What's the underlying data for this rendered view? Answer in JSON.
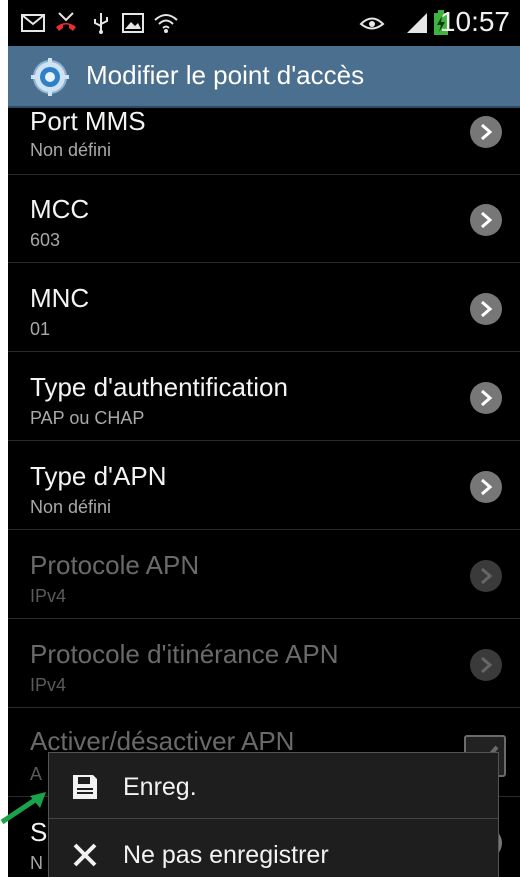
{
  "status_bar": {
    "time": "10:57",
    "icons": [
      "mail-icon",
      "missed-call-icon",
      "usb-icon",
      "gallery-icon",
      "wifi-icon",
      "smart-stay-eye-icon",
      "signal-icon",
      "battery-charging-icon"
    ]
  },
  "action_bar": {
    "title": "Modifier le point d'accès",
    "icon": "gear-icon"
  },
  "settings": [
    {
      "title": "Port MMS",
      "value": "Non défini",
      "enabled": true
    },
    {
      "title": "MCC",
      "value": "603",
      "enabled": true
    },
    {
      "title": "MNC",
      "value": "01",
      "enabled": true
    },
    {
      "title": "Type d'authentification",
      "value": "PAP ou CHAP",
      "enabled": true
    },
    {
      "title": "Type d'APN",
      "value": "Non défini",
      "enabled": true
    },
    {
      "title": "Protocole APN",
      "value": "IPv4",
      "enabled": false
    },
    {
      "title": "Protocole d'itinérance APN",
      "value": "IPv4",
      "enabled": false
    },
    {
      "title": "Activer/désactiver APN",
      "value": "A",
      "enabled": false
    },
    {
      "title": "S",
      "value": "N",
      "enabled": true
    }
  ],
  "menu": {
    "save_label": "Enreg.",
    "discard_label": "Ne pas enregistrer"
  },
  "colors": {
    "action_bar": "#4b6f8e",
    "background": "#000000",
    "arrow": "#1aa34a"
  }
}
